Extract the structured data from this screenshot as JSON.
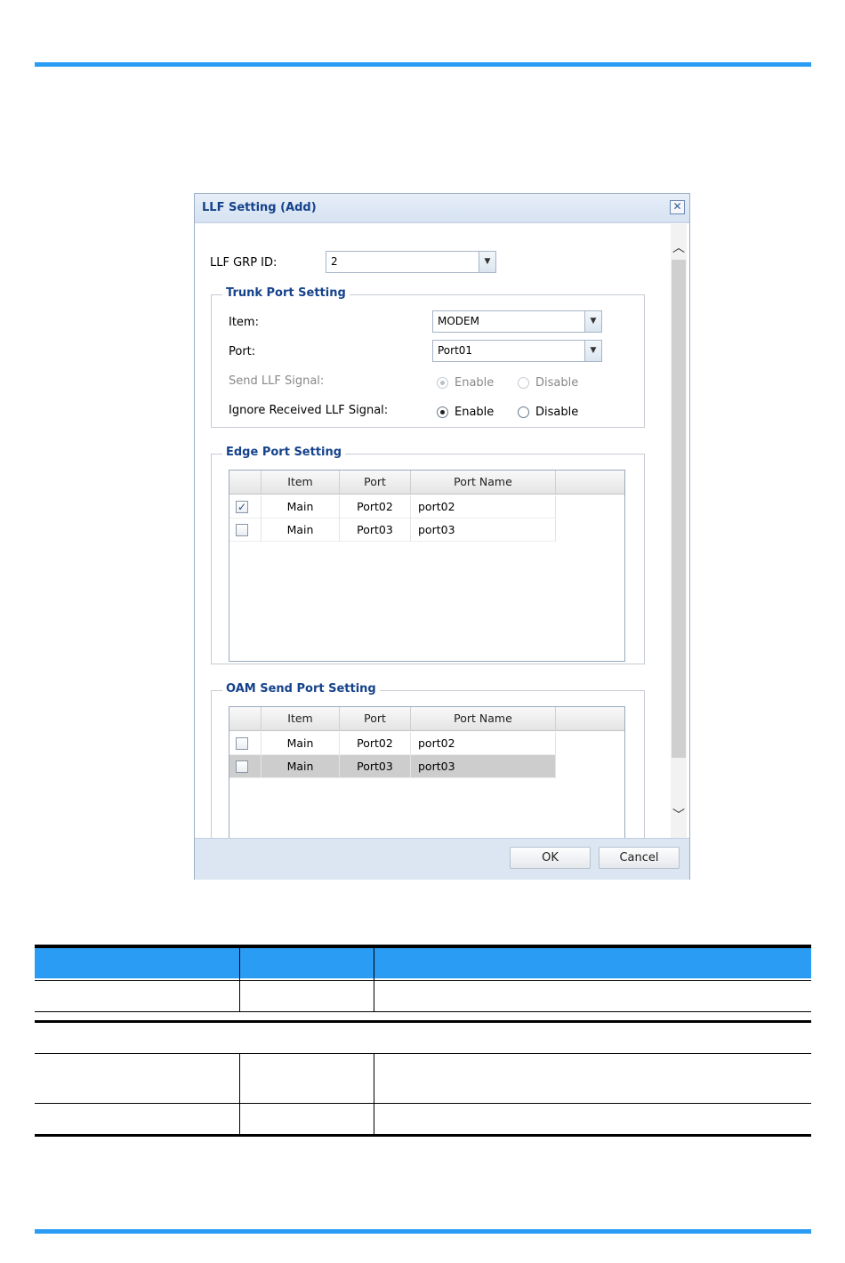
{
  "dialog": {
    "title": "LLF Setting (Add)",
    "close_glyph": "✕",
    "grp_id_label": "LLF GRP ID:",
    "grp_id_value": "2",
    "trunk": {
      "legend": "Trunk Port Setting",
      "item_label": "Item:",
      "item_value": "MODEM",
      "port_label": "Port:",
      "port_value": "Port01",
      "send_label": "Send LLF Signal:",
      "ignore_label": "Ignore Received LLF Signal:",
      "enable": "Enable",
      "disable": "Disable"
    },
    "edge": {
      "legend": "Edge Port Setting",
      "columns": [
        "Item",
        "Port",
        "Port Name"
      ],
      "rows": [
        {
          "item": "Main",
          "port": "Port02",
          "name": "port02",
          "checked": true
        },
        {
          "item": "Main",
          "port": "Port03",
          "name": "port03",
          "checked": false
        }
      ]
    },
    "oam": {
      "legend": "OAM Send Port Setting",
      "columns": [
        "Item",
        "Port",
        "Port Name"
      ],
      "rows": [
        {
          "item": "Main",
          "port": "Port02",
          "name": "port02",
          "checked": false
        },
        {
          "item": "Main",
          "port": "Port03",
          "name": "port03",
          "checked": false
        }
      ]
    },
    "ok_label": "OK",
    "cancel_label": "Cancel"
  },
  "colors": {
    "accent": "#2b9cf4",
    "title_text": "#15428b",
    "selected_row": "#cdcdcd"
  }
}
